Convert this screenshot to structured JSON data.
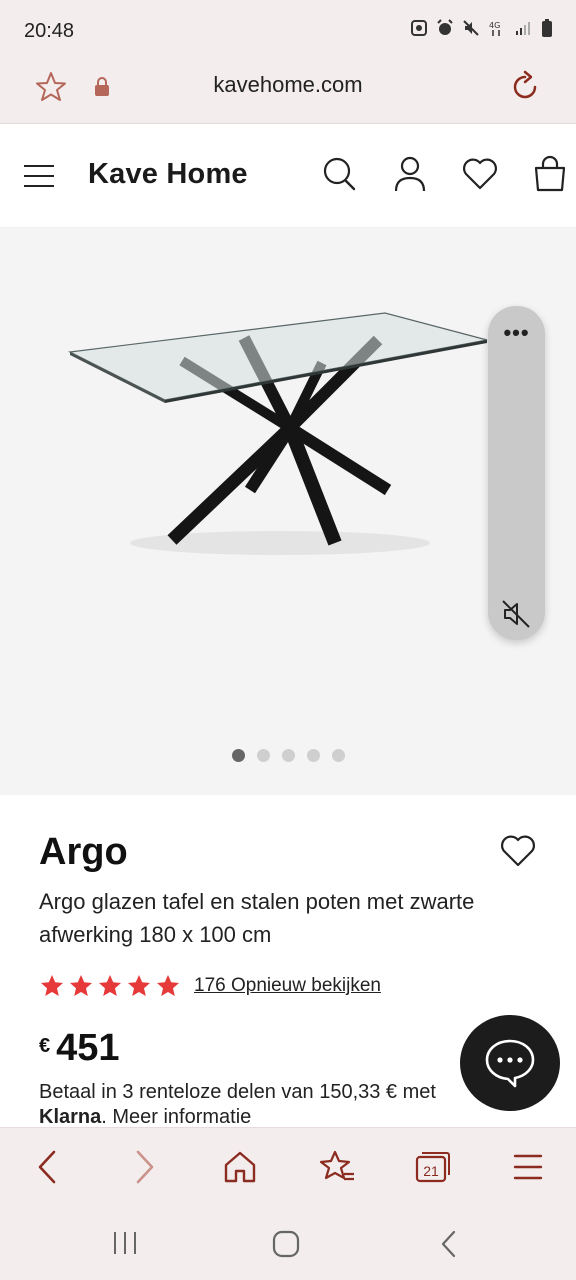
{
  "status_bar": {
    "time": "20:48"
  },
  "browser": {
    "url": "kavehome.com",
    "tabs_count": "21"
  },
  "site": {
    "logo": "Kave Home"
  },
  "gallery": {
    "dots": 5,
    "active_dot": 0
  },
  "product": {
    "title": "Argo",
    "description": "Argo glazen tafel en stalen poten met zwarte afwerking 180 x 100 cm",
    "rating_stars": 5,
    "reviews_label": "176 Opnieuw bekijken",
    "currency": "€",
    "price": "451",
    "klarna_text_pre": "Betaal in 3 renteloze delen van 150,33 € met",
    "klarna_brand": "Klarna",
    "klarna_text_post": ". Meer informatie"
  },
  "colors": {
    "accent": "#8c2b1f",
    "star": "#e63a3a",
    "chrome_bg": "#f3eded"
  }
}
